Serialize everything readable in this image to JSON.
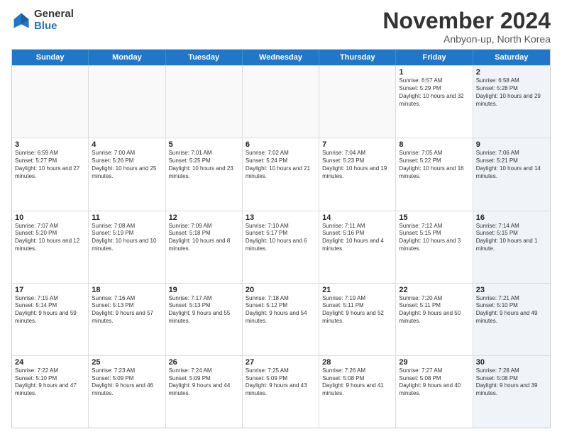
{
  "logo": {
    "general": "General",
    "blue": "Blue"
  },
  "title": "November 2024",
  "subtitle": "Anbyon-up, North Korea",
  "header_days": [
    "Sunday",
    "Monday",
    "Tuesday",
    "Wednesday",
    "Thursday",
    "Friday",
    "Saturday"
  ],
  "rows": [
    [
      {
        "day": "",
        "info": "",
        "shaded": false,
        "empty": true
      },
      {
        "day": "",
        "info": "",
        "shaded": false,
        "empty": true
      },
      {
        "day": "",
        "info": "",
        "shaded": false,
        "empty": true
      },
      {
        "day": "",
        "info": "",
        "shaded": false,
        "empty": true
      },
      {
        "day": "",
        "info": "",
        "shaded": false,
        "empty": true
      },
      {
        "day": "1",
        "info": "Sunrise: 6:57 AM\nSunset: 5:29 PM\nDaylight: 10 hours and 32 minutes.",
        "shaded": false,
        "empty": false
      },
      {
        "day": "2",
        "info": "Sunrise: 6:58 AM\nSunset: 5:28 PM\nDaylight: 10 hours and 29 minutes.",
        "shaded": true,
        "empty": false
      }
    ],
    [
      {
        "day": "3",
        "info": "Sunrise: 6:59 AM\nSunset: 5:27 PM\nDaylight: 10 hours and 27 minutes.",
        "shaded": false,
        "empty": false
      },
      {
        "day": "4",
        "info": "Sunrise: 7:00 AM\nSunset: 5:26 PM\nDaylight: 10 hours and 25 minutes.",
        "shaded": false,
        "empty": false
      },
      {
        "day": "5",
        "info": "Sunrise: 7:01 AM\nSunset: 5:25 PM\nDaylight: 10 hours and 23 minutes.",
        "shaded": false,
        "empty": false
      },
      {
        "day": "6",
        "info": "Sunrise: 7:02 AM\nSunset: 5:24 PM\nDaylight: 10 hours and 21 minutes.",
        "shaded": false,
        "empty": false
      },
      {
        "day": "7",
        "info": "Sunrise: 7:04 AM\nSunset: 5:23 PM\nDaylight: 10 hours and 19 minutes.",
        "shaded": false,
        "empty": false
      },
      {
        "day": "8",
        "info": "Sunrise: 7:05 AM\nSunset: 5:22 PM\nDaylight: 10 hours and 16 minutes.",
        "shaded": false,
        "empty": false
      },
      {
        "day": "9",
        "info": "Sunrise: 7:06 AM\nSunset: 5:21 PM\nDaylight: 10 hours and 14 minutes.",
        "shaded": true,
        "empty": false
      }
    ],
    [
      {
        "day": "10",
        "info": "Sunrise: 7:07 AM\nSunset: 5:20 PM\nDaylight: 10 hours and 12 minutes.",
        "shaded": false,
        "empty": false
      },
      {
        "day": "11",
        "info": "Sunrise: 7:08 AM\nSunset: 5:19 PM\nDaylight: 10 hours and 10 minutes.",
        "shaded": false,
        "empty": false
      },
      {
        "day": "12",
        "info": "Sunrise: 7:09 AM\nSunset: 5:18 PM\nDaylight: 10 hours and 8 minutes.",
        "shaded": false,
        "empty": false
      },
      {
        "day": "13",
        "info": "Sunrise: 7:10 AM\nSunset: 5:17 PM\nDaylight: 10 hours and 6 minutes.",
        "shaded": false,
        "empty": false
      },
      {
        "day": "14",
        "info": "Sunrise: 7:11 AM\nSunset: 5:16 PM\nDaylight: 10 hours and 4 minutes.",
        "shaded": false,
        "empty": false
      },
      {
        "day": "15",
        "info": "Sunrise: 7:12 AM\nSunset: 5:15 PM\nDaylight: 10 hours and 3 minutes.",
        "shaded": false,
        "empty": false
      },
      {
        "day": "16",
        "info": "Sunrise: 7:14 AM\nSunset: 5:15 PM\nDaylight: 10 hours and 1 minute.",
        "shaded": true,
        "empty": false
      }
    ],
    [
      {
        "day": "17",
        "info": "Sunrise: 7:15 AM\nSunset: 5:14 PM\nDaylight: 9 hours and 59 minutes.",
        "shaded": false,
        "empty": false
      },
      {
        "day": "18",
        "info": "Sunrise: 7:16 AM\nSunset: 5:13 PM\nDaylight: 9 hours and 57 minutes.",
        "shaded": false,
        "empty": false
      },
      {
        "day": "19",
        "info": "Sunrise: 7:17 AM\nSunset: 5:13 PM\nDaylight: 9 hours and 55 minutes.",
        "shaded": false,
        "empty": false
      },
      {
        "day": "20",
        "info": "Sunrise: 7:18 AM\nSunset: 5:12 PM\nDaylight: 9 hours and 54 minutes.",
        "shaded": false,
        "empty": false
      },
      {
        "day": "21",
        "info": "Sunrise: 7:19 AM\nSunset: 5:11 PM\nDaylight: 9 hours and 52 minutes.",
        "shaded": false,
        "empty": false
      },
      {
        "day": "22",
        "info": "Sunrise: 7:20 AM\nSunset: 5:11 PM\nDaylight: 9 hours and 50 minutes.",
        "shaded": false,
        "empty": false
      },
      {
        "day": "23",
        "info": "Sunrise: 7:21 AM\nSunset: 5:10 PM\nDaylight: 9 hours and 49 minutes.",
        "shaded": true,
        "empty": false
      }
    ],
    [
      {
        "day": "24",
        "info": "Sunrise: 7:22 AM\nSunset: 5:10 PM\nDaylight: 9 hours and 47 minutes.",
        "shaded": false,
        "empty": false
      },
      {
        "day": "25",
        "info": "Sunrise: 7:23 AM\nSunset: 5:09 PM\nDaylight: 9 hours and 46 minutes.",
        "shaded": false,
        "empty": false
      },
      {
        "day": "26",
        "info": "Sunrise: 7:24 AM\nSunset: 5:09 PM\nDaylight: 9 hours and 44 minutes.",
        "shaded": false,
        "empty": false
      },
      {
        "day": "27",
        "info": "Sunrise: 7:25 AM\nSunset: 5:09 PM\nDaylight: 9 hours and 43 minutes.",
        "shaded": false,
        "empty": false
      },
      {
        "day": "28",
        "info": "Sunrise: 7:26 AM\nSunset: 5:08 PM\nDaylight: 9 hours and 41 minutes.",
        "shaded": false,
        "empty": false
      },
      {
        "day": "29",
        "info": "Sunrise: 7:27 AM\nSunset: 5:08 PM\nDaylight: 9 hours and 40 minutes.",
        "shaded": false,
        "empty": false
      },
      {
        "day": "30",
        "info": "Sunrise: 7:28 AM\nSunset: 5:08 PM\nDaylight: 9 hours and 39 minutes.",
        "shaded": true,
        "empty": false
      }
    ]
  ]
}
